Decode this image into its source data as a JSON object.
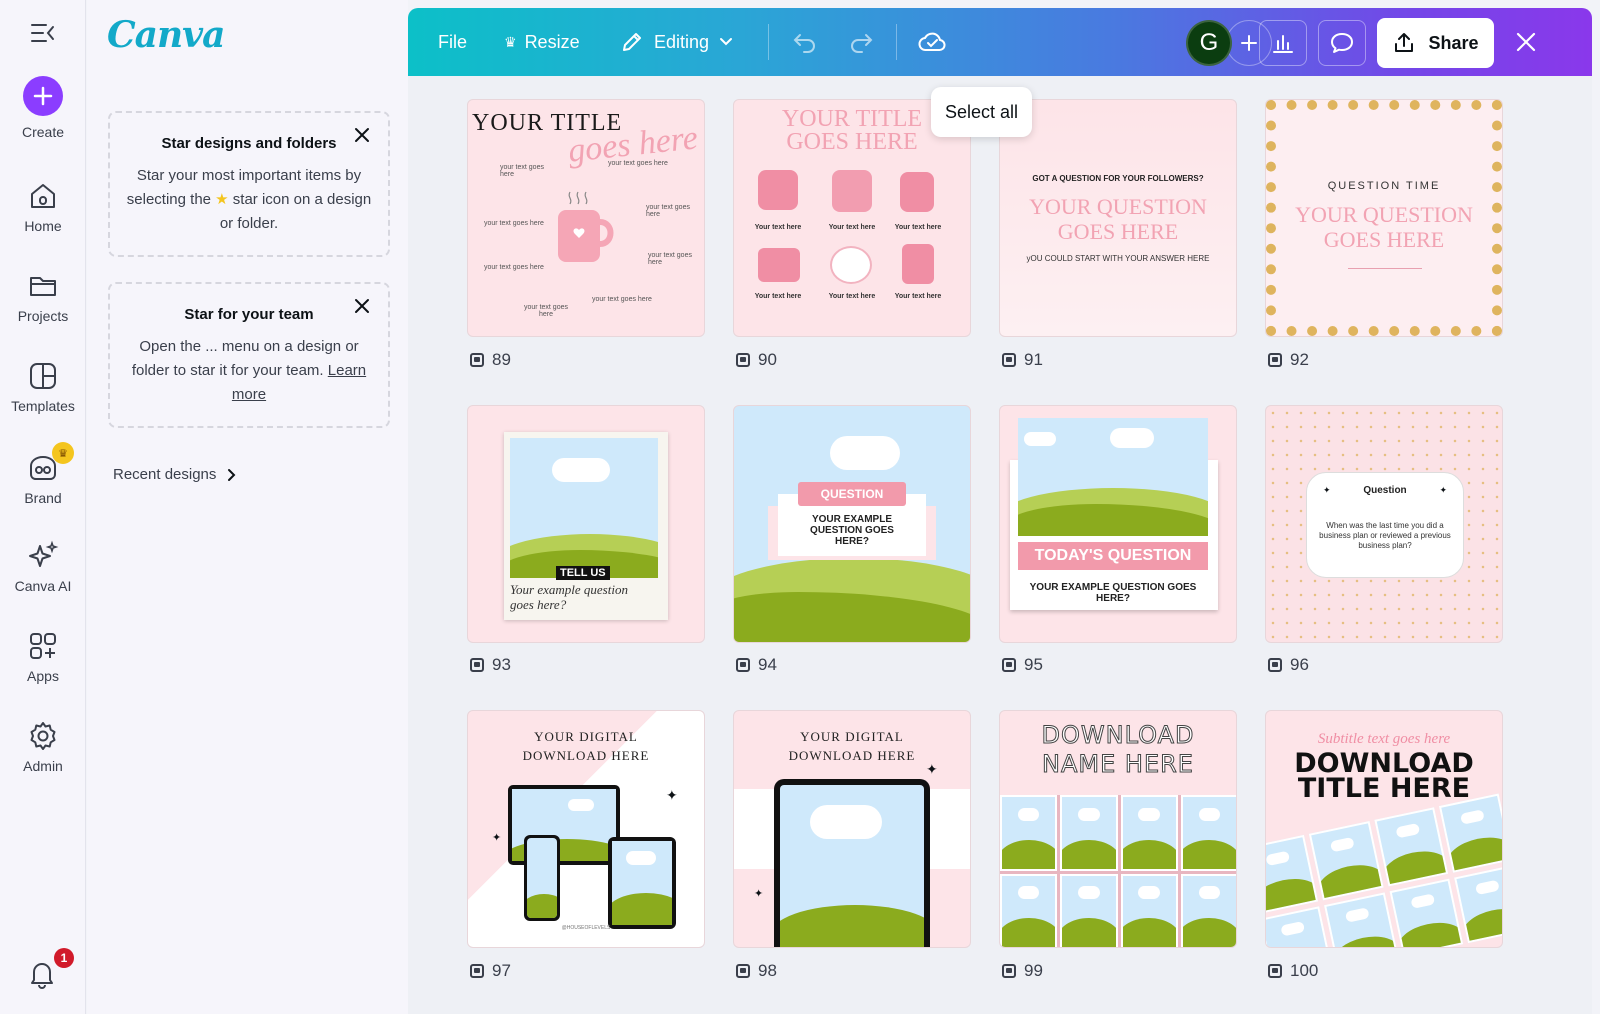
{
  "rail": {
    "create": "Create",
    "home": "Home",
    "projects": "Projects",
    "templates": "Templates",
    "brand": "Brand",
    "canva_ai": "Canva AI",
    "apps": "Apps",
    "admin": "Admin",
    "notifications_count": "1"
  },
  "panel": {
    "logo": "Canva",
    "tip1_title": "Star designs and folders",
    "tip1_body_a": "Star your most important items by selecting the ",
    "tip1_body_b": " star icon on a design or folder.",
    "tip2_title": "Star for your team",
    "tip2_body": "Open the ... menu on a design or folder to star it for your team. ",
    "tip2_link": "Learn more",
    "recent": "Recent designs"
  },
  "toolbar": {
    "file": "File",
    "resize": "Resize",
    "editing": "Editing",
    "avatar_letter": "G",
    "share": "Share"
  },
  "tooltip": "Select all",
  "pages": [
    {
      "num": "89"
    },
    {
      "num": "90"
    },
    {
      "num": "91"
    },
    {
      "num": "92"
    },
    {
      "num": "93"
    },
    {
      "num": "94"
    },
    {
      "num": "95"
    },
    {
      "num": "96"
    },
    {
      "num": "97"
    },
    {
      "num": "98"
    },
    {
      "num": "99"
    },
    {
      "num": "100"
    }
  ],
  "thumbs": {
    "t89_title1": "YOUR TITLE",
    "t89_title2": "goes here",
    "t89_label": "your text goes here",
    "t90_title1": "YOUR TITLE",
    "t90_title2": "GOES HERE",
    "t90_label": "Your text here",
    "t91_top": "GOT A QUESTION FOR YOUR FOLLOWERS?",
    "t91_q1": "YOUR QUESTION",
    "t91_q2": "GOES HERE",
    "t91_sub": "yOU COULD START WITH YOUR ANSWER HERE",
    "t92_top": "QUESTION TIME",
    "t92_q1": "YOUR QUESTION",
    "t92_q2": "GOES HERE",
    "t93_tag": "TELL US",
    "t93_q1": "Your example question",
    "t93_q2": "goes here?",
    "t94_tag": "QUESTION",
    "t94_q": "YOUR EXAMPLE QUESTION GOES HERE?",
    "t95_tag": "TODAY'S QUESTION",
    "t95_q": "YOUR EXAMPLE QUESTION GOES HERE?",
    "t96_title": "Question",
    "t96_q": "When was the last time you did a business plan or reviewed a previous business plan?",
    "t97_title1": "YOUR DIGITAL",
    "t97_title2": "DOWNLOAD HERE",
    "t97_credit": "@HOUSEOFLEVELS",
    "t98_title1": "YOUR DIGITAL",
    "t98_title2": "DOWNLOAD HERE",
    "t99_title1": "DOWNLOAD",
    "t99_title2": "NAME HERE",
    "t100_sub": "Subtitle text goes here",
    "t100_title1": "DOWNLOAD",
    "t100_title2": "TITLE HERE"
  },
  "colors": {
    "accent": "#8b3dff",
    "pink_bg": "#fde4e8",
    "pink_text": "#f2a3b3",
    "green": "#8bab1e",
    "sky": "#cfe9fb"
  }
}
